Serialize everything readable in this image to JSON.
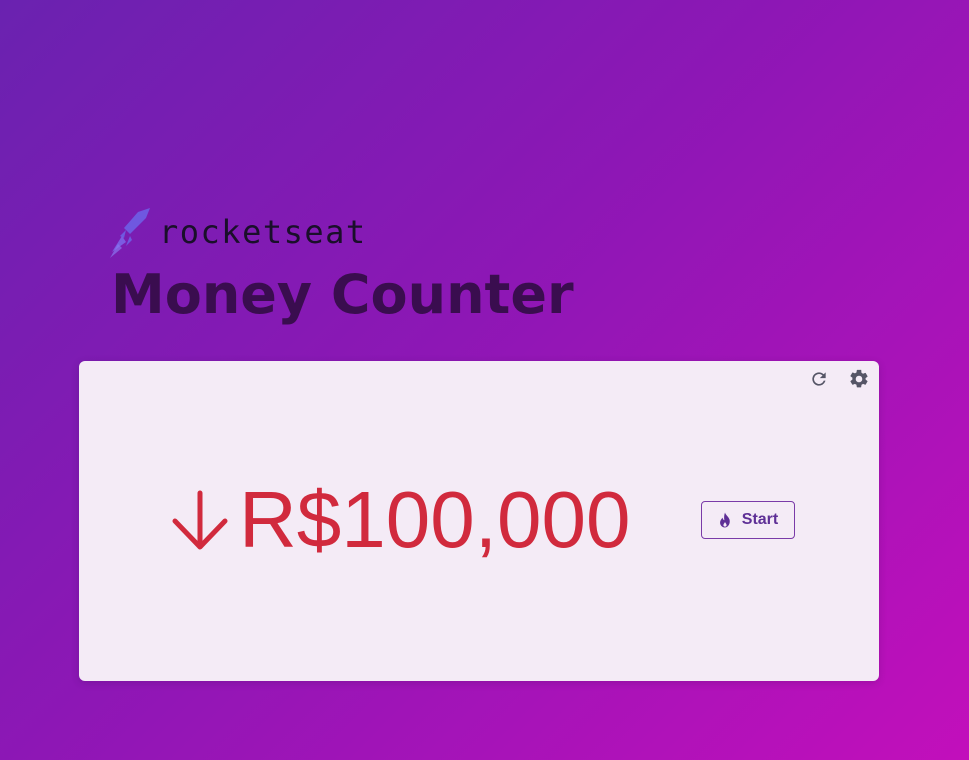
{
  "brand": {
    "name": "rocketseat",
    "logo_icon": "rocket-logo-icon",
    "logo_color": "#6f58e0"
  },
  "header": {
    "title": "Money Counter"
  },
  "counter": {
    "amount": "R$100,000",
    "direction_icon": "arrow-down-icon",
    "amount_color": "#d12a3d"
  },
  "toolbar": {
    "reset_icon": "refresh-icon",
    "settings_icon": "gear-icon"
  },
  "actions": {
    "start_label": "Start",
    "start_icon": "flame-icon",
    "accent_color": "#5e2f96"
  },
  "colors": {
    "card_background": "#f4ebf6",
    "gradient_start": "#6a22b0",
    "gradient_end": "#c20fbb"
  }
}
